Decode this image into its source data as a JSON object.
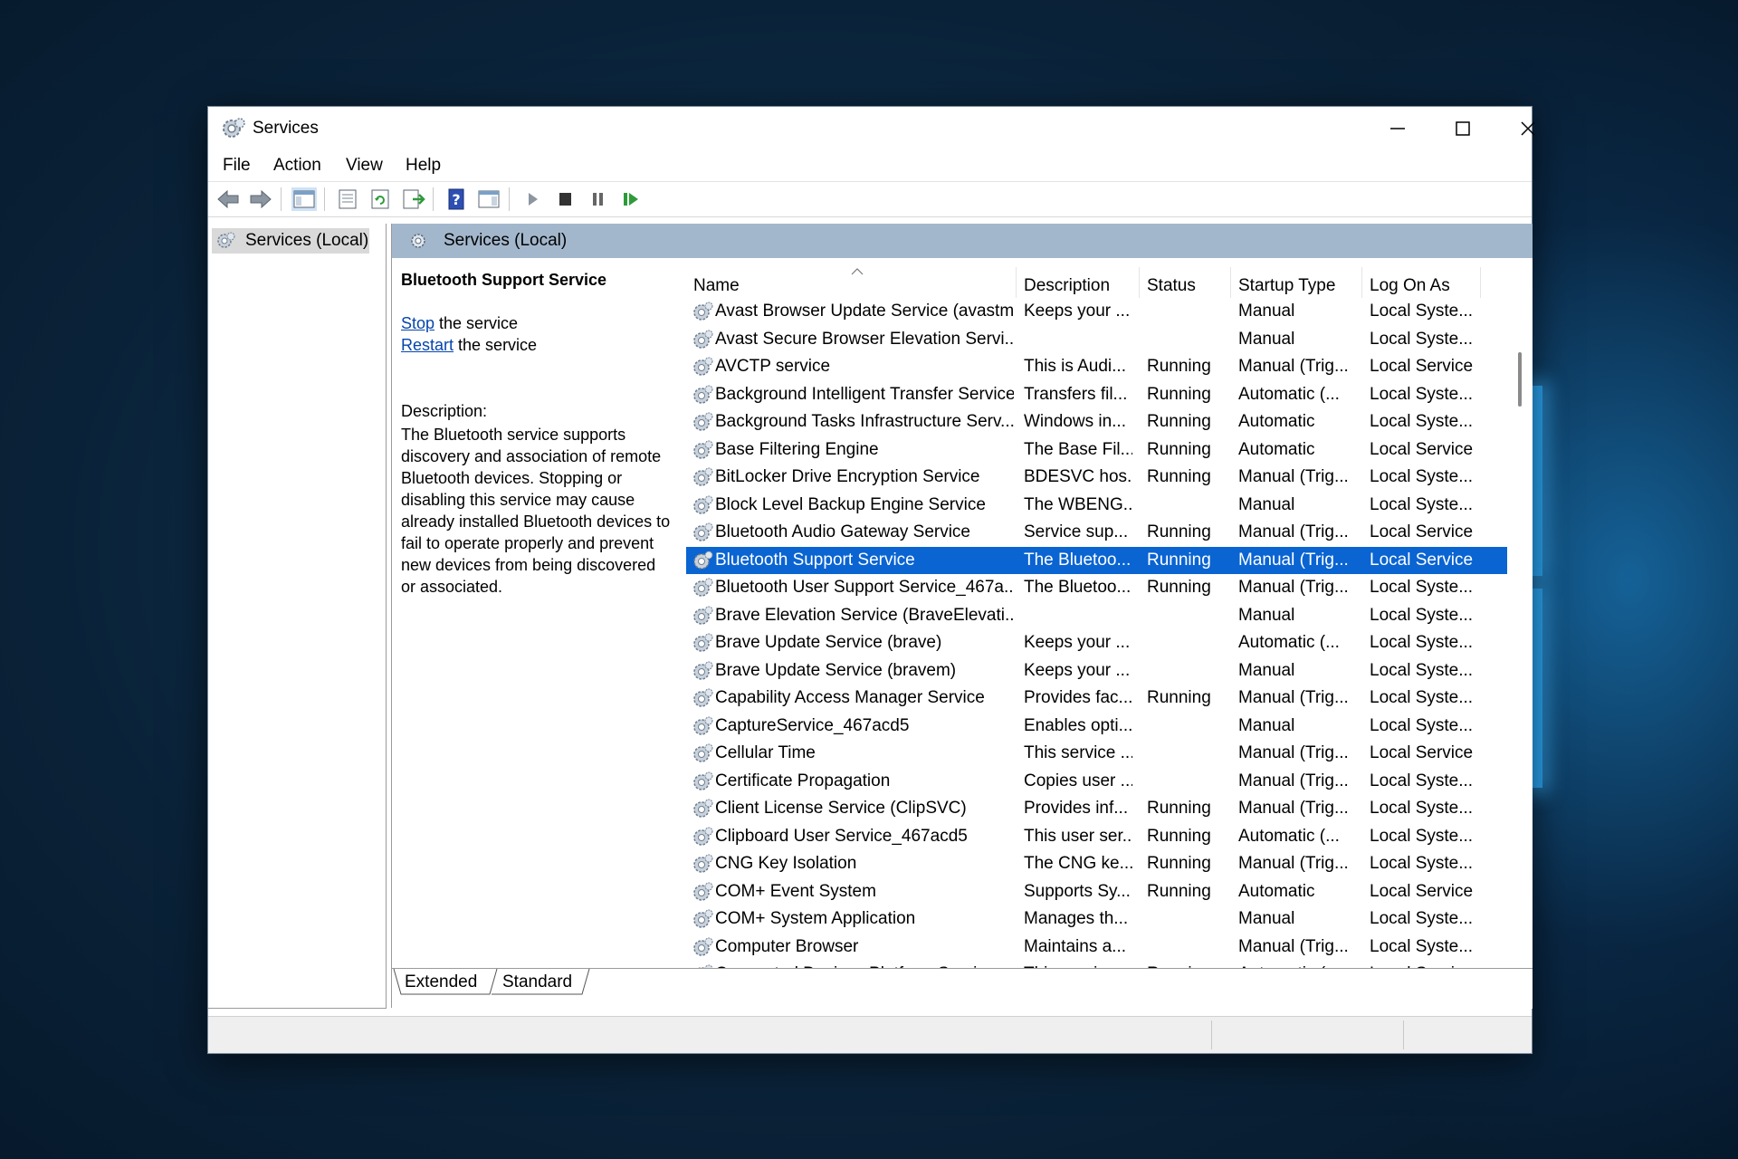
{
  "window": {
    "title": "Services"
  },
  "menu": [
    "File",
    "Action",
    "View",
    "Help"
  ],
  "tree": {
    "item": "Services (Local)"
  },
  "main": {
    "header": "Services (Local)"
  },
  "desc": {
    "title": "Bluetooth Support Service",
    "stop_link": "Stop",
    "stop_rest": " the service",
    "restart_link": "Restart",
    "restart_rest": " the service",
    "label": "Description:",
    "body": "The Bluetooth service supports\ndiscovery and association of remote\nBluetooth devices.  Stopping or\ndisabling this service may cause\nalready installed Bluetooth devices to\nfail to operate properly and prevent\nnew devices from being discovered\nor associated."
  },
  "columns": [
    "Name",
    "Description",
    "Status",
    "Startup Type",
    "Log On As"
  ],
  "rows": [
    [
      "Avast Browser Update Service (avastm)",
      "Keeps your ...",
      "",
      "Manual",
      "Local Syste..."
    ],
    [
      "Avast Secure Browser Elevation Servi...",
      "",
      "",
      "Manual",
      "Local Syste..."
    ],
    [
      "AVCTP service",
      "This is Audi...",
      "Running",
      "Manual (Trig...",
      "Local Service"
    ],
    [
      "Background Intelligent Transfer Service",
      "Transfers fil...",
      "Running",
      "Automatic (...",
      "Local Syste..."
    ],
    [
      "Background Tasks Infrastructure Serv...",
      "Windows in...",
      "Running",
      "Automatic",
      "Local Syste..."
    ],
    [
      "Base Filtering Engine",
      "The Base Fil...",
      "Running",
      "Automatic",
      "Local Service"
    ],
    [
      "BitLocker Drive Encryption Service",
      "BDESVC hos...",
      "Running",
      "Manual (Trig...",
      "Local Syste..."
    ],
    [
      "Block Level Backup Engine Service",
      "The WBENG...",
      "",
      "Manual",
      "Local Syste..."
    ],
    [
      "Bluetooth Audio Gateway Service",
      "Service sup...",
      "Running",
      "Manual (Trig...",
      "Local Service"
    ],
    [
      "Bluetooth Support Service",
      "The Bluetoo...",
      "Running",
      "Manual (Trig...",
      "Local Service"
    ],
    [
      "Bluetooth User Support Service_467a...",
      "The Bluetoo...",
      "Running",
      "Manual (Trig...",
      "Local Syste..."
    ],
    [
      "Brave Elevation Service (BraveElevati...",
      "",
      "",
      "Manual",
      "Local Syste..."
    ],
    [
      "Brave Update Service (brave)",
      "Keeps your ...",
      "",
      "Automatic (...",
      "Local Syste..."
    ],
    [
      "Brave Update Service (bravem)",
      "Keeps your ...",
      "",
      "Manual",
      "Local Syste..."
    ],
    [
      "Capability Access Manager Service",
      "Provides fac...",
      "Running",
      "Manual (Trig...",
      "Local Syste..."
    ],
    [
      "CaptureService_467acd5",
      "Enables opti...",
      "",
      "Manual",
      "Local Syste..."
    ],
    [
      "Cellular Time",
      "This service ...",
      "",
      "Manual (Trig...",
      "Local Service"
    ],
    [
      "Certificate Propagation",
      "Copies user ...",
      "",
      "Manual (Trig...",
      "Local Syste..."
    ],
    [
      "Client License Service (ClipSVC)",
      "Provides inf...",
      "Running",
      "Manual (Trig...",
      "Local Syste..."
    ],
    [
      "Clipboard User Service_467acd5",
      "This user ser...",
      "Running",
      "Automatic (...",
      "Local Syste..."
    ],
    [
      "CNG Key Isolation",
      "The CNG ke...",
      "Running",
      "Manual (Trig...",
      "Local Syste..."
    ],
    [
      "COM+ Event System",
      "Supports Sy...",
      "Running",
      "Automatic",
      "Local Service"
    ],
    [
      "COM+ System Application",
      "Manages th...",
      "",
      "Manual",
      "Local Syste..."
    ],
    [
      "Computer Browser",
      "Maintains a...",
      "",
      "Manual (Trig...",
      "Local Syste..."
    ],
    [
      "Connected Devices Platform Service",
      "This service ...",
      "Running",
      "Automatic (...",
      "Local Service"
    ]
  ],
  "selected_row": 9,
  "tabs": [
    "Extended",
    "Standard"
  ],
  "colors": {
    "selection": "#0a64d2",
    "header_band": "#a3b7cc",
    "link": "#0645ad"
  }
}
